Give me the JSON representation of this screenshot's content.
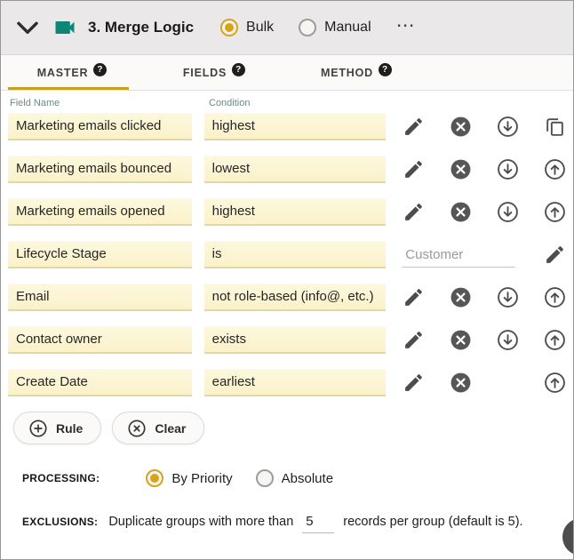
{
  "ui": {
    "help_glyph": "?",
    "more_glyph": "⋯"
  },
  "header": {
    "title": "3. Merge Logic",
    "modes": [
      {
        "label": "Bulk",
        "selected": true
      },
      {
        "label": "Manual",
        "selected": false
      }
    ]
  },
  "tabs": [
    {
      "label": "MASTER",
      "active": true
    },
    {
      "label": "FIELDS",
      "active": false
    },
    {
      "label": "METHOD",
      "active": false
    }
  ],
  "columns": {
    "field_name": "Field Name",
    "condition": "Condition"
  },
  "rules": [
    {
      "field": "Marketing emails clicked",
      "condition": "highest"
    },
    {
      "field": "Marketing emails bounced",
      "condition": "lowest"
    },
    {
      "field": "Marketing emails opened",
      "condition": "highest"
    },
    {
      "field": "Lifecycle Stage",
      "condition": "is",
      "value": "Customer"
    },
    {
      "field": "Email",
      "condition": "not role-based (info@, etc.)"
    },
    {
      "field": "Contact owner",
      "condition": "exists"
    },
    {
      "field": "Create Date",
      "condition": "earliest"
    }
  ],
  "actions_bar": {
    "rule": "Rule",
    "clear": "Clear"
  },
  "processing": {
    "label": "PROCESSING:",
    "options": [
      {
        "label": "By Priority",
        "selected": true
      },
      {
        "label": "Absolute",
        "selected": false
      }
    ]
  },
  "exclusions": {
    "label": "EXCLUSIONS:",
    "text_before": "Duplicate groups with more than",
    "value": "5",
    "text_after": "records per group (default is 5)."
  },
  "colors": {
    "accent_gold": "#c7a01e",
    "teal": "#0d8577",
    "input_bg": "#fcf4d1"
  }
}
